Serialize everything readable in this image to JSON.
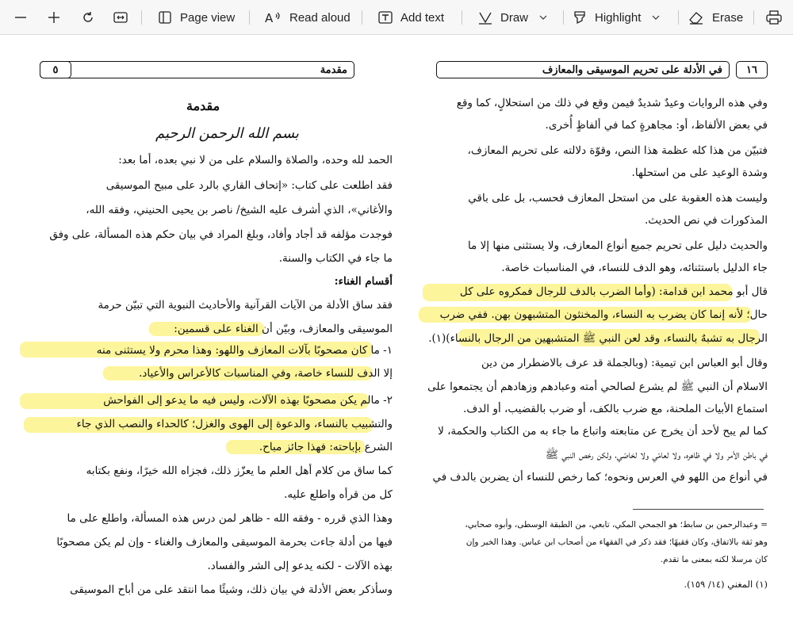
{
  "toolbar": {
    "page_view": "Page view",
    "read_aloud": "Read aloud",
    "add_text": "Add text",
    "draw": "Draw",
    "highlight": "Highlight",
    "erase": "Erase"
  },
  "colors": {
    "highlight": "#fbf38a",
    "toolbar_bg": "#f7f7f7",
    "text": "#111111"
  },
  "left_page": {
    "header_title": "مقدمة",
    "page_number": "٥",
    "title": "مقدمة",
    "basmala": "بسم الله الرحمن الرحيم",
    "lines": [
      "الحمد لله وحده، والصلاة والسلام على من لا نبي بعده، أما بعد:",
      "فقد اطلعت على كتاب: «إتحاف القاري بالرد على مبيح الموسيقى",
      "والأغاني»، الذي أشرف عليه الشيخ/ ناصر بن يحيى الحنيني، وفقه الله،",
      "فوجدت مؤلفه قد أجاد وأفاد، وبلغ المراد في بيان حكم هذه المسألة، على وفق",
      "ما جاء في الكتاب والسنة.",
      "أقسام الغناء:",
      "فقد ساق الأدلة من الآيات القرآنية والأحاديث النبوية التي تبيّن حرمة",
      "الموسيقى والمعازف، وبيّن أن الغناء على قسمين:",
      "١- ما كان مصحوبًا بآلات المعازف واللهو: وهذا محرم ولا يستثنى منه",
      "إلا الدف للنساء خاصة، وفي المناسبات كالأعراس والأعياد.",
      "٢- مالم يكن مصحوبًا بهذه الآلات، وليس فيه ما يدعو إلى الفواحش",
      "والتشبيب بالنساء، والدعوة إلى الهوى والغزل؛ كالحداء والنصب الذي جاء",
      "الشرع بإباحته: فهذا جائز مباح.",
      "كما ساق من كلام أهل العلم ما يعزّز ذلك، فجزاه الله خيرًا، ونفع بكتابه",
      "كل من قرأه واطلع عليه.",
      "وهذا الذي قرره - وفقه الله - ظاهر لمن درس هذه المسألة، واطلع على ما",
      "فيها من أدلة جاءت بحرمة الموسيقى والمعازف والغناء - وإن لم يكن مصحوبًا",
      "بهذه الآلات - لكنه يدعو إلى الشر والفساد.",
      "وسأذكر بعض الأدلة في بيان ذلك، وشيئًا مما انتقد على من أباح الموسيقى"
    ]
  },
  "right_page": {
    "header_title": "في الأدلة على تحريم الموسيقى والمعازف",
    "page_number": "١٦",
    "lines": [
      "وفي هذه الروايات وعيدٌ شديدٌ فيمن وقع في ذلك من استحلالٍ، كما وقع",
      "في بعض الألفاظ، أو: مجاهرةٍ كما في ألفاظٍ أُخرى.",
      "فتبيّن من هذا كله عظمة هذا النص، وقوّة دلالته على تحريم المعازف،",
      "وشدة الوعيد على من استحلها.",
      "وليست هذه العقوبة على من استحل المعازف فحسب، بل على باقي",
      "المذكورات في نص الحديث.",
      "والحديث دليل على تحريم جميع أنواع المعازف، ولا يستثنى منها إلا ما",
      "جاء الدليل باستثنائه، وهو الدف للنساء، في المناسبات خاصة.",
      "قال أبو محمد ابن قدامة: (وأما الضرب بالدف للرجال فمكروه على كل",
      "حال؛ لأنه إنما كان يضرب به النساء، والمخنثون المتشبهون بهن. ففي ضرب",
      "الرجال به تشبهٌ بالنساء، وقد لعن النبي ﷺ المتشبهين من الرجال بالنساء)(١).",
      "وقال أبو العباس ابن تيمية: (وبالجملة قد عرف بالاضطرار من دين",
      "الاسلام أن النبي ﷺ لم يشرع لصالحي أمته وعبادهم وزهادهم أن يجتمعوا على",
      "استماع الأبيات الملحنة، مع ضرب بالكف، أو ضرب بالقضيب، أو الدف.",
      "كما لم يبح لأحد أن يخرج عن متابعته واتباع ما جاء به من الكتاب والحكمة، لا",
      "في باطن الأمر ولا في ظاهره، ولا لعامّي ولا لخاصّي، ولكن رخص النبي ﷺ",
      "في أنواع من اللهو في العرس ونحوه؛ كما رخص للنساء أن يضربن بالدف في"
    ],
    "footnotes": [
      "= وعبدالرحمن بن سابط؛ هو الجمحي المكي، تابعي، من الطبقة الوسطى، وأبوه صحابي،",
      "وهو ثقة بالاتفاق، وكان فقيهًا؛ فقد ذكر في الفقهاء من أصحاب ابن عباس. وهذا الخبر وإن",
      "كان مرسلا لكنه بمعنى ما تقدم."
    ],
    "footnote_ref": "(١)  المغني (١٤/ ١٥٩)."
  }
}
